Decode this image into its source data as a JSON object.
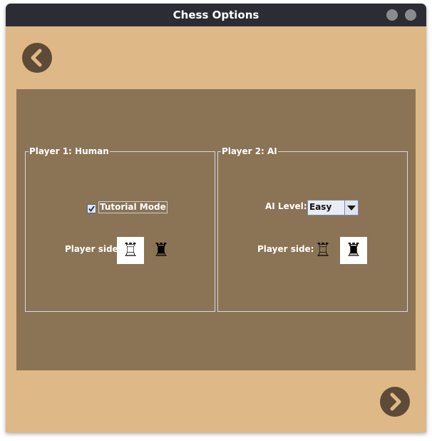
{
  "window": {
    "title": "Chess Options"
  },
  "navigation": {
    "back_icon": "chevron-left-icon",
    "next_icon": "chevron-right-icon"
  },
  "player1": {
    "group_title": "Player 1: Human",
    "tutorial_label": "Tutorial Mode",
    "tutorial_checked": true,
    "side_label": "Player side:",
    "white_piece": "♖",
    "black_piece": "♜",
    "selected_side": "white"
  },
  "player2": {
    "group_title": "Player 2: AI",
    "ai_level_label": "AI Level:",
    "ai_level_value": "Easy",
    "side_label": "Player side:",
    "white_piece": "♖",
    "black_piece": "♜",
    "selected_side": "black"
  },
  "colors": {
    "window_bg": "#deb887",
    "panel_bg": "#8b7355",
    "titlebar_bg": "#2c2d34",
    "nav_button": "#5d4a37"
  }
}
